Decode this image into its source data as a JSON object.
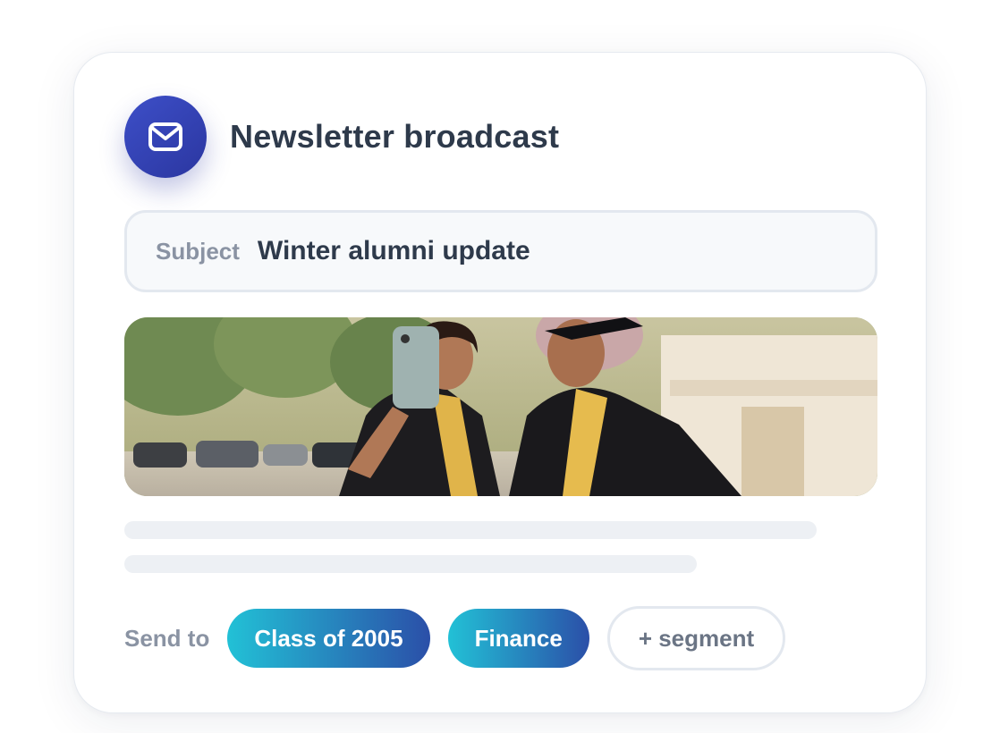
{
  "card": {
    "title": "Newsletter broadcast",
    "icon": "mail-icon"
  },
  "subject": {
    "label": "Subject",
    "value": "Winter alumni update"
  },
  "image": {
    "description_icon": "photo-graduates-selfie"
  },
  "recipients": {
    "label": "Send to",
    "segments": [
      {
        "label": "Class of 2005"
      },
      {
        "label": "Finance"
      }
    ],
    "add_label": "+ segment"
  },
  "colors": {
    "accent_start": "#22c1d6",
    "accent_end": "#2b4fa8",
    "badge": "#3d4fc8",
    "title_text": "#2e3a4b",
    "muted_text": "#8a93a3"
  }
}
